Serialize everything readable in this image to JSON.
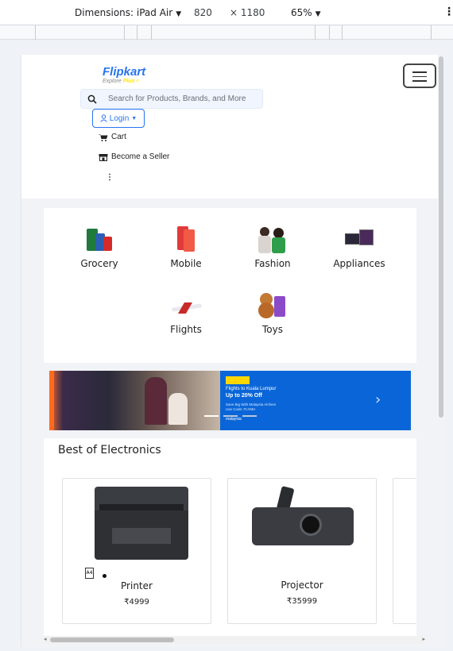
{
  "devtools": {
    "device_label": "Dimensions: iPad Air",
    "width": "820",
    "height": "× 1180",
    "zoom": "65%"
  },
  "header": {
    "logo_name": "Flipkart",
    "logo_sub_1": "Explore",
    "logo_sub_2": "Plus",
    "search_placeholder": "Search for Products, Brands, and More",
    "login_label": "Login",
    "cart_label": "Cart",
    "seller_label": "Become a Seller",
    "more_label": "⋮"
  },
  "categories": [
    {
      "label": "Grocery",
      "icon": "grocery-icon"
    },
    {
      "label": "Mobile",
      "icon": "mobile-icon"
    },
    {
      "label": "Fashion",
      "icon": "fashion-icon"
    },
    {
      "label": "Appliances",
      "icon": "appliances-icon"
    },
    {
      "label": "Flights",
      "icon": "flights-icon"
    },
    {
      "label": "Toys",
      "icon": "toys-icon"
    }
  ],
  "banner": {
    "line1": "Flights to Kuala Lumpur",
    "line2": "Up to 20% Off",
    "line3": "Save Big With Malaysia Airlines",
    "line4": "Use Code: FLYMH",
    "brand": "malaysia"
  },
  "electronics": {
    "title": "Best of Electronics",
    "items": [
      {
        "name": "Printer",
        "price": "₹4999"
      },
      {
        "name": "Projector",
        "price": "₹35999"
      }
    ]
  },
  "colors": {
    "brand_blue": "#2874f0",
    "brand_yellow": "#ffe500",
    "banner_blue": "#0a66d8"
  }
}
